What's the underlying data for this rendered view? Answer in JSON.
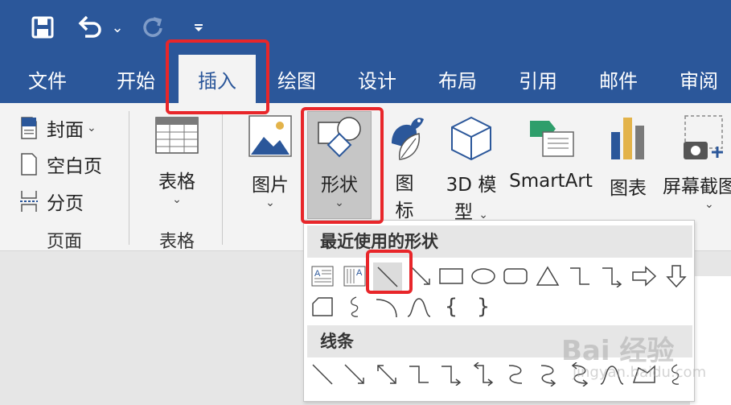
{
  "quick_access": {
    "save_icon": "save-icon",
    "undo_icon": "undo-icon",
    "undo_caret": "⌄",
    "redo_icon": "redo-icon",
    "customize_icon": "customize-caret-icon"
  },
  "tabs": [
    {
      "label": "文件"
    },
    {
      "label": "开始"
    },
    {
      "label": "插入"
    },
    {
      "label": "绘图"
    },
    {
      "label": "设计"
    },
    {
      "label": "布局"
    },
    {
      "label": "引用"
    },
    {
      "label": "邮件"
    },
    {
      "label": "审阅"
    }
  ],
  "ribbon": {
    "pages_group": {
      "cover": "封面",
      "cover_caret": "⌄",
      "blank": "空白页",
      "break": "分页",
      "label": "页面"
    },
    "table_group": {
      "button": "表格",
      "caret": "⌄",
      "label": "表格"
    },
    "picture": {
      "label": "图片",
      "caret": "⌄"
    },
    "shapes": {
      "label": "形状",
      "caret": "⌄"
    },
    "icons": {
      "line1": "图",
      "line2": "标"
    },
    "model3d": {
      "line1": "3D 模",
      "line2": "型",
      "caret": "⌄"
    },
    "smartart": {
      "label": "SmartArt"
    },
    "chart": {
      "label": "图表"
    },
    "screenshot": {
      "label": "屏幕截图",
      "caret": "⌄"
    }
  },
  "shapes_dropdown": {
    "recent_header": "最近使用的形状",
    "lines_header": "线条",
    "brace_left": "{",
    "brace_right": "}"
  },
  "watermark": {
    "main": "Bai 经验",
    "sub": "jingyan.baidu.com"
  },
  "colors": {
    "brand": "#2b579a",
    "highlight": "#e8262a"
  }
}
